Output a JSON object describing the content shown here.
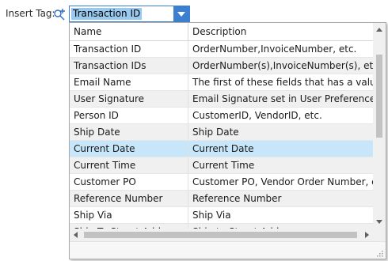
{
  "toolbar": {
    "insert_tag_label": "Insert Tag:",
    "combo_value": "Transaction ID",
    "icon": "tag-link-icon",
    "accent_color": "#3c7fd1"
  },
  "dropdown": {
    "columns": [
      "Name",
      "Description"
    ],
    "selected_row": 6,
    "rows": [
      {
        "name": "Transaction ID",
        "description": "OrderNumber,InvoiceNumber, etc."
      },
      {
        "name": "Transaction IDs",
        "description": "OrderNumber(s),InvoiceNumber(s), etc."
      },
      {
        "name": "Email Name",
        "description": "The first of these fields that has a value: Co"
      },
      {
        "name": "User Signature",
        "description": "Email Signature set in User Preferences"
      },
      {
        "name": "Person ID",
        "description": "CustomerID, VendorID, etc."
      },
      {
        "name": "Ship Date",
        "description": "Ship Date"
      },
      {
        "name": "Current Date",
        "description": "Current Date"
      },
      {
        "name": "Current Time",
        "description": "Current Time"
      },
      {
        "name": "Customer PO",
        "description": "Customer PO, Vendor Order Number, etc"
      },
      {
        "name": "Reference Number",
        "description": "Reference Number"
      },
      {
        "name": "Ship Via",
        "description": "Ship Via"
      },
      {
        "name": "Ship To Street Address",
        "description": "Ship to Street Address"
      }
    ]
  }
}
